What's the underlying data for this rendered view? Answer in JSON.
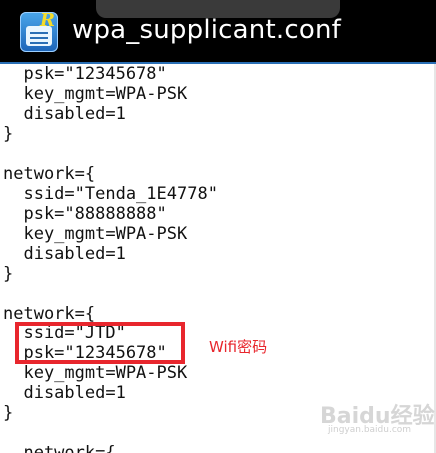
{
  "window": {
    "title": "wpa_supplicant.conf"
  },
  "app_icon": {
    "name": "editor-app-icon",
    "badge": "R"
  },
  "editor": {
    "lines": [
      "  psk=\"12345678\"",
      "  key_mgmt=WPA-PSK",
      "  disabled=1",
      "}",
      "",
      "network={",
      "  ssid=\"Tenda_1E4778\"",
      "  psk=\"88888888\"",
      "  key_mgmt=WPA-PSK",
      "  disabled=1",
      "}",
      "",
      "network={",
      "  ssid=\"JTD\"",
      "  psk=\"12345678\"",
      "  key_mgmt=WPA-PSK",
      "  disabled=1",
      "}",
      "",
      "  network={"
    ]
  },
  "annotation": {
    "text": "Wifi密码",
    "color": "#e8262d"
  },
  "watermark": {
    "text": "Baidu经验",
    "subtext": "jingyan.baidu.com"
  },
  "colors": {
    "titlebar": "#000000",
    "accent": "#2a6fb5",
    "highlight": "#e8262d"
  }
}
